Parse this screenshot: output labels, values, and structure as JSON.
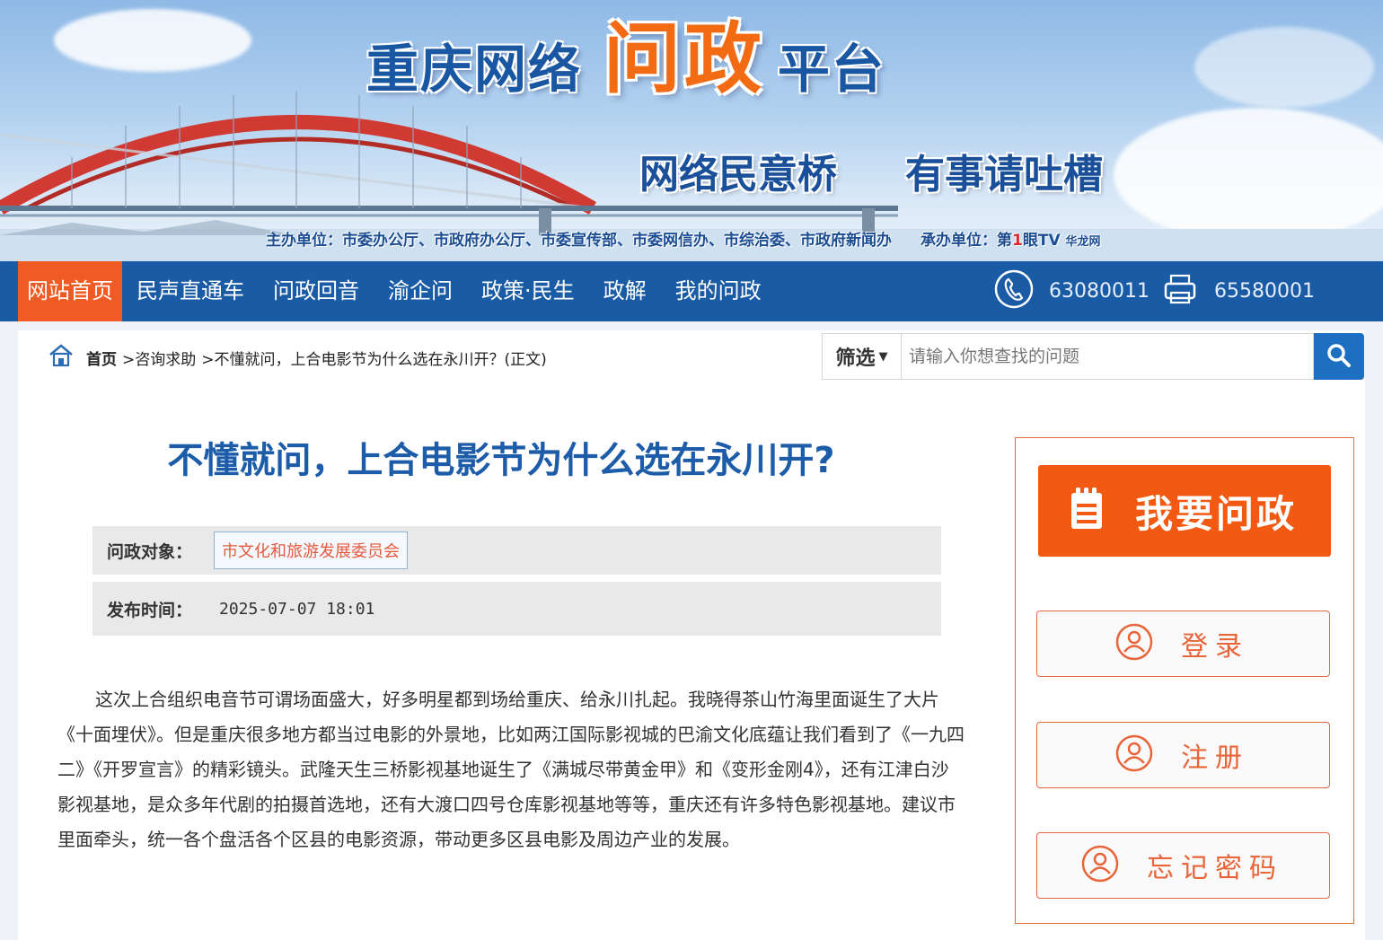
{
  "banner": {
    "title_part1": "重庆网络",
    "title_part2": "问政",
    "title_part3": "平台",
    "slogan_left": "网络民意桥",
    "slogan_right": "有事请吐槽",
    "organizers": "主办单位：市委办公厅、市政府办公厅、市委宣传部、市委网信办、市综治委、市政府新闻办",
    "co_organizer_label": "承办单位：",
    "co_organizer_logo_a": "第",
    "co_organizer_logo_b": "1",
    "co_organizer_logo_c": "眼TV",
    "co_organizer_logo_d": "华龙网"
  },
  "nav": {
    "items": [
      {
        "label": "网站首页",
        "active": true
      },
      {
        "label": "民声直通车"
      },
      {
        "label": "问政回音"
      },
      {
        "label": "渝企问"
      },
      {
        "label": "政策·民生"
      },
      {
        "label": "政解"
      },
      {
        "label": "我的问政"
      }
    ],
    "phone": "63080011",
    "fax": "65580001"
  },
  "breadcrumb": {
    "home": "首页",
    "seg1": ">咨询求助",
    "seg2": ">不懂就问，上合电影节为什么选在永川开？(正文)"
  },
  "search": {
    "filter_label": "筛选",
    "placeholder": "请输入你想查找的问题"
  },
  "article": {
    "title": "不懂就问，上合电影节为什么选在永川开?",
    "target_label": "问政对象：",
    "target_value": "市文化和旅游发展委员会",
    "time_label": "发布时间：",
    "time_value": "2025-07-07 18:01",
    "body": "这次上合组织电音节可谓场面盛大，好多明星都到场给重庆、给永川扎起。我晓得茶山竹海里面诞生了大片《十面埋伏》。但是重庆很多地方都当过电影的外景地，比如两江国际影视城的巴渝文化底蕴让我们看到了《一九四二》《开罗宣言》的精彩镜头。武隆天生三桥影视基地诞生了《满城尽带黄金甲》和《变形金刚4》，还有江津白沙影视基地，是众多年代剧的拍摄首选地，还有大渡口四号仓库影视基地等等，重庆还有许多特色影视基地。建议市里面牵头，统一各个盘活各个区县的电影资源，带动更多区县电影及周边产业的发展。"
  },
  "sidebar": {
    "ask_label": "我要问政",
    "login_label": "登录",
    "register_label": "注册",
    "forgot_label": "忘记密码"
  },
  "colors": {
    "nav_bg": "#1a5ba6",
    "nav_active": "#f05a23",
    "title_blue": "#1c5ca8",
    "accent_orange": "#f25a14"
  }
}
